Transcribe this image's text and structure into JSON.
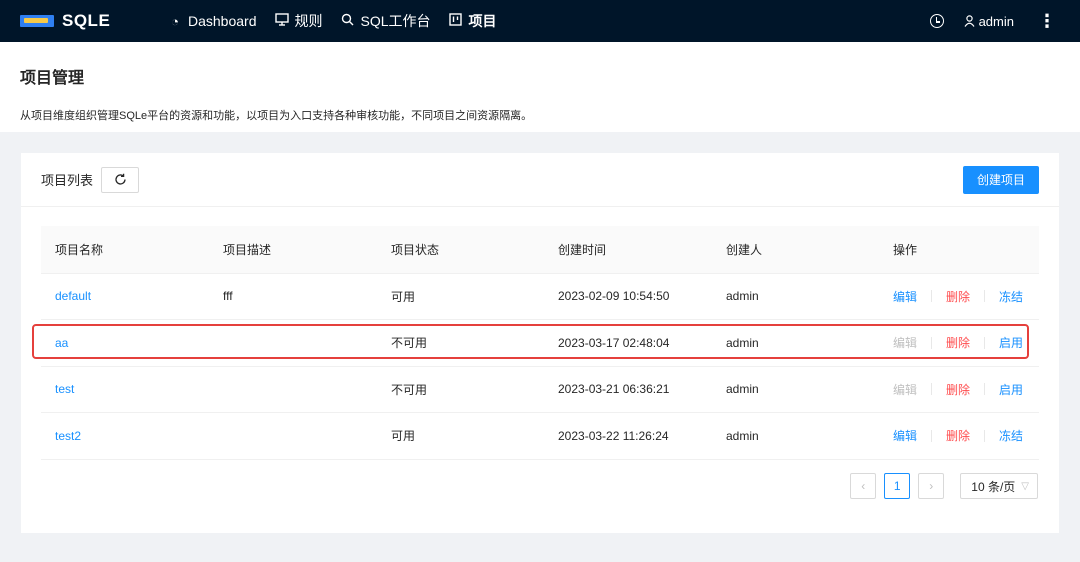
{
  "header": {
    "logo_text": "SQLE",
    "nav": [
      {
        "icon": "dashboard-icon",
        "label": "Dashboard"
      },
      {
        "icon": "monitor-icon",
        "label": "规则"
      },
      {
        "icon": "search-icon",
        "label": "SQL工作台"
      },
      {
        "icon": "project-icon",
        "label": "项目"
      }
    ],
    "user": "admin"
  },
  "page": {
    "title": "项目管理",
    "description": "从项目维度组织管理SQLe平台的资源和功能，以项目为入口支持各种审核功能，不同项目之间资源隔离。"
  },
  "card": {
    "title": "项目列表",
    "create_label": "创建项目"
  },
  "table": {
    "columns": [
      "项目名称",
      "项目描述",
      "项目状态",
      "创建时间",
      "创建人",
      "操作"
    ],
    "rows": [
      {
        "name": "default",
        "desc": "fff",
        "status": "可用",
        "created": "2023-02-09 10:54:50",
        "creator": "admin",
        "edit": "编辑",
        "delete": "删除",
        "action": "冻结"
      },
      {
        "name": "aa",
        "desc": "",
        "status": "不可用",
        "created": "2023-03-17 02:48:04",
        "creator": "admin",
        "edit": "编辑",
        "delete": "删除",
        "action": "启用"
      },
      {
        "name": "test",
        "desc": "",
        "status": "不可用",
        "created": "2023-03-21 06:36:21",
        "creator": "admin",
        "edit": "编辑",
        "delete": "删除",
        "action": "启用"
      },
      {
        "name": "test2",
        "desc": "",
        "status": "可用",
        "created": "2023-03-22 11:26:24",
        "creator": "admin",
        "edit": "编辑",
        "delete": "删除",
        "action": "冻结"
      }
    ]
  },
  "pagination": {
    "current": "1",
    "page_size": "10 条/页"
  },
  "colors": {
    "header_bg": "#001529",
    "primary": "#1890ff",
    "danger": "#ff4d4f",
    "highlight": "#e5403c"
  }
}
